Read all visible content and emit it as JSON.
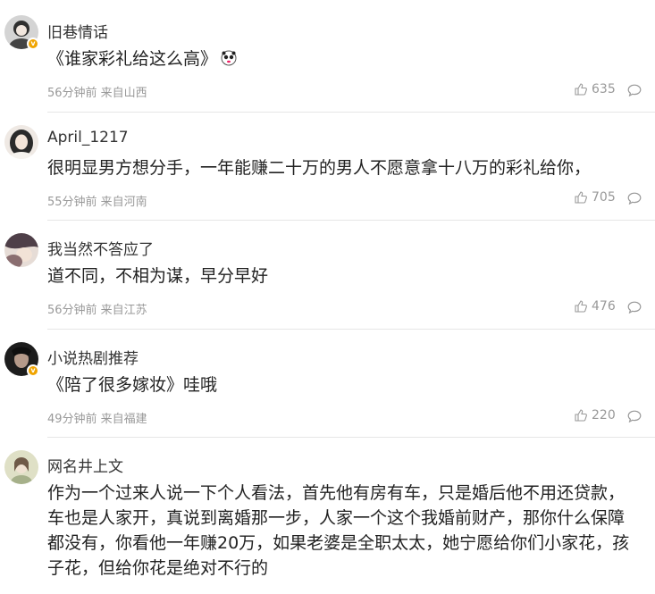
{
  "comments": [
    {
      "username": "旧巷情话",
      "text": "《谁家彩礼给这么高》",
      "meta": "56分钟前 来自山西",
      "likes": "635",
      "verified": true,
      "avatar_colors": [
        "#3a3a3a",
        "#c9c9c9"
      ]
    },
    {
      "username": "April_1217",
      "text": "很明显男方想分手，一年能赚二十万的男人不愿意拿十八万的彩礼给你，",
      "meta": "55分钟前 来自河南",
      "likes": "705",
      "verified": false,
      "avatar_colors": [
        "#2b2b2b",
        "#e8dcd0"
      ]
    },
    {
      "username": "我当然不答应了",
      "text": "道不同，不相为谋，早分早好",
      "meta": "56分钟前 来自江苏",
      "likes": "476",
      "verified": false,
      "avatar_colors": [
        "#5b4a52",
        "#d9c8c0"
      ]
    },
    {
      "username": "小说热剧推荐",
      "text": "《陪了很多嫁妆》哇哦",
      "meta": "49分钟前 来自福建",
      "likes": "220",
      "verified": true,
      "avatar_colors": [
        "#1e1e1e",
        "#7a6a60"
      ]
    },
    {
      "username": "网名井上文",
      "text": "作为一个过来人说一下个人看法，首先他有房有车，只是婚后他不用还贷款，车也是人家开，真说到离婚那一步，人家一个这个我婚前财产，那你什么保障都没有，你看他一年赚20万，如果老婆是全职太太，她宁愿给你们小家花，孩子花，但给你花是绝对不行的",
      "verified": false,
      "avatar_colors": [
        "#d8d6b8",
        "#9aa07a"
      ]
    }
  ],
  "icons": {
    "like": "thumbs-up-icon",
    "reply": "comment-bubble-icon",
    "verified": "verified-badge-icon",
    "emoji": "panda-emoji-icon"
  }
}
